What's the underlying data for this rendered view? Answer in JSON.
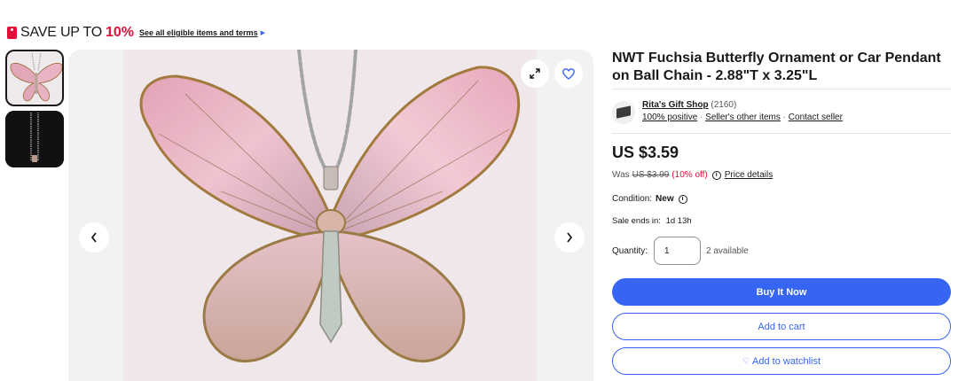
{
  "promo": {
    "text": "SAVE UP TO",
    "percent": "10%",
    "link": "See all eligible items and terms",
    "tag_icon": "promo-tag-icon",
    "accent": "#e0103a"
  },
  "gallery": {
    "thumbnails": [
      {
        "name": "thumbnail-butterfly-front"
      },
      {
        "name": "thumbnail-butterfly-chain"
      }
    ]
  },
  "product": {
    "title": "NWT Fuchsia Butterfly Ornament or Car Pendant on Ball Chain - 2.88\"T x 3.25\"L"
  },
  "seller": {
    "name": "Rita's Gift Shop",
    "feedback_count": "(2160)",
    "positive": "100% positive",
    "other_items": "Seller's other items",
    "contact": "Contact seller",
    "separator": "·"
  },
  "pricing": {
    "price": "US $3.59",
    "was_label": "Was",
    "was_price": "US $3.99",
    "discount": "(10% off)",
    "details_link": "Price details",
    "info_icon": "i"
  },
  "condition": {
    "label": "Condition:",
    "value": "New",
    "info_icon": "i"
  },
  "sale": {
    "label": "Sale ends in:",
    "value": "1d 13h"
  },
  "quantity": {
    "label": "Quantity:",
    "value": "1",
    "available": "2 available"
  },
  "actions": {
    "buy_now": "Buy It Now",
    "add_to_cart": "Add to cart",
    "add_to_watchlist": "Add to watchlist",
    "watch_icon": "♡",
    "primary_color": "#3665f3"
  },
  "icons": {
    "expand": "expand-icon",
    "heart": "heart-icon",
    "prev": "chevron-left-icon",
    "next": "chevron-right-icon"
  }
}
